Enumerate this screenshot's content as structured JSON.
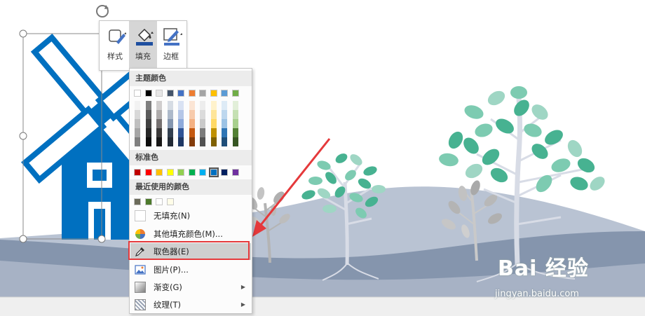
{
  "toolbar": {
    "style_label": "样式",
    "fill_label": "填充",
    "border_label": "边框"
  },
  "fill_menu": {
    "theme_colors_label": "主题颜色",
    "standard_colors_label": "标准色",
    "recent_colors_label": "最近使用的颜色",
    "no_fill_label": "无填充(N)",
    "more_fill_colors_label": "其他填充颜色(M)...",
    "eyedropper_label": "取色器(E)",
    "picture_label": "图片(P)...",
    "gradient_label": "渐变(G)",
    "texture_label": "纹理(T)",
    "theme_top_row": [
      "#ffffff",
      "#000000",
      "#e7e6e6",
      "#44546a",
      "#4472c4",
      "#ed7d31",
      "#a5a5a5",
      "#ffc000",
      "#5b9bd5",
      "#70ad47"
    ],
    "theme_shades": [
      [
        "#f2f2f2",
        "#7f7f7f",
        "#d0cece",
        "#d6dce4",
        "#d9e2f3",
        "#fbe5d5",
        "#ededed",
        "#fff2cc",
        "#deebf6",
        "#e2efd9"
      ],
      [
        "#d8d8d8",
        "#595959",
        "#aeabab",
        "#adb9ca",
        "#b4c6e7",
        "#f7cbac",
        "#dbdbdb",
        "#fee599",
        "#bdd7ee",
        "#c5e0b3"
      ],
      [
        "#bfbfbf",
        "#3f3f3f",
        "#757070",
        "#8496b0",
        "#8eaadb",
        "#f4b183",
        "#c9c9c9",
        "#ffd965",
        "#9cc3e5",
        "#a8d08d"
      ],
      [
        "#a5a5a5",
        "#262626",
        "#3a3838",
        "#323f4f",
        "#2f5496",
        "#c45911",
        "#7b7b7b",
        "#bf9000",
        "#2e75b5",
        "#538135"
      ],
      [
        "#7f7f7f",
        "#0c0c0c",
        "#171616",
        "#222a35",
        "#1e3763",
        "#833c0b",
        "#525252",
        "#7f6000",
        "#1e4e79",
        "#375623"
      ]
    ],
    "standard_colors": [
      "#c00000",
      "#ff0000",
      "#ffc000",
      "#ffff00",
      "#92d050",
      "#00b050",
      "#00b0f0",
      "#0070c0",
      "#002060",
      "#7030a0"
    ],
    "recent_colors": [
      "#6b6b5a",
      "#4d7a2c",
      "#ffffff",
      "#fffde8"
    ]
  },
  "watermark": {
    "brand_text": "Bai 经验",
    "url_text": "jingyan.baidu.com"
  },
  "colors": {
    "windmill_blue": "#0070c0",
    "hill_dark": "#8595ad",
    "hill_light": "#b9c3d3",
    "leaf_teal": "#47b291",
    "leaf_light": "#7dcbb1",
    "tree_grey": "#b4b4b4",
    "highlight_red": "#e5393b"
  },
  "icons": [
    "rotate-handle-icon",
    "shape-style-icon",
    "paint-bucket-icon",
    "pen-outline-icon",
    "color-wheel-icon",
    "eyedropper-icon",
    "picture-icon",
    "gradient-icon",
    "texture-icon"
  ]
}
